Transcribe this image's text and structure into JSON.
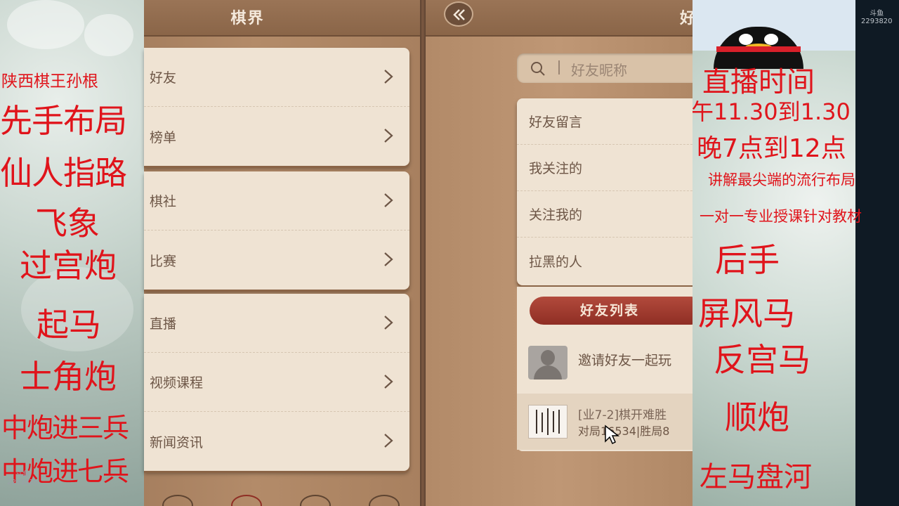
{
  "left_overlay": {
    "lines": [
      "陕西棋王孙根",
      "先手布局",
      "仙人指路",
      "飞象",
      "过宫炮",
      "起马",
      "士角炮",
      "中炮进三兵",
      "中炮进七兵"
    ]
  },
  "panel1": {
    "title": "棋界",
    "groups": [
      [
        "好友",
        "榜单"
      ],
      [
        "棋社",
        "比赛"
      ],
      [
        "直播",
        "视频课程",
        "新闻资讯"
      ]
    ]
  },
  "panel2": {
    "title_partial": "好",
    "search_placeholder": "好友昵称",
    "menu": [
      "好友留言",
      "我关注的",
      "关注我的",
      "拉黑的人"
    ],
    "friends_list_label": "好友列表",
    "invite_text": "邀请好友一起玩",
    "friend": {
      "name": "[业7-2]棋开难胜",
      "stats": "对局16534|胜局8"
    }
  },
  "right_overlay": {
    "lines": [
      "直播时间",
      "午11.30到1.30",
      "晚7点到12点",
      "讲解最尖端的流行布局",
      "一对一专业授课针对教材",
      "后手",
      "屏风马",
      "反宫马",
      "顺炮",
      "左马盘河"
    ]
  },
  "watermarks": {
    "brand": "斗鱼",
    "room_id": "2293820"
  },
  "colors": {
    "overlay_text": "#e0141b",
    "wood": "#b08866",
    "card": "#efe3d3",
    "friends_button": "#a33d30"
  }
}
